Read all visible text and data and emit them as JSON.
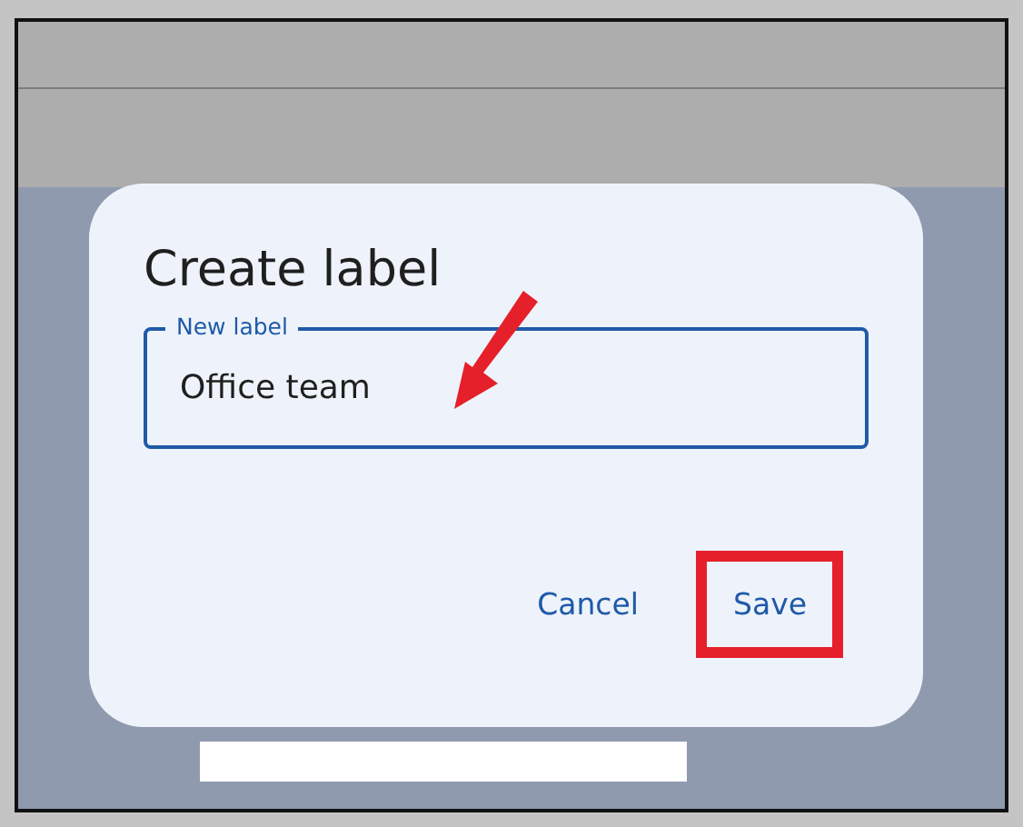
{
  "dialog": {
    "title": "Create label",
    "field": {
      "label": "New label",
      "value": "Office team"
    },
    "buttons": [
      {
        "label": "Cancel",
        "highlighted": false
      },
      {
        "label": "Save",
        "highlighted": true
      }
    ]
  }
}
